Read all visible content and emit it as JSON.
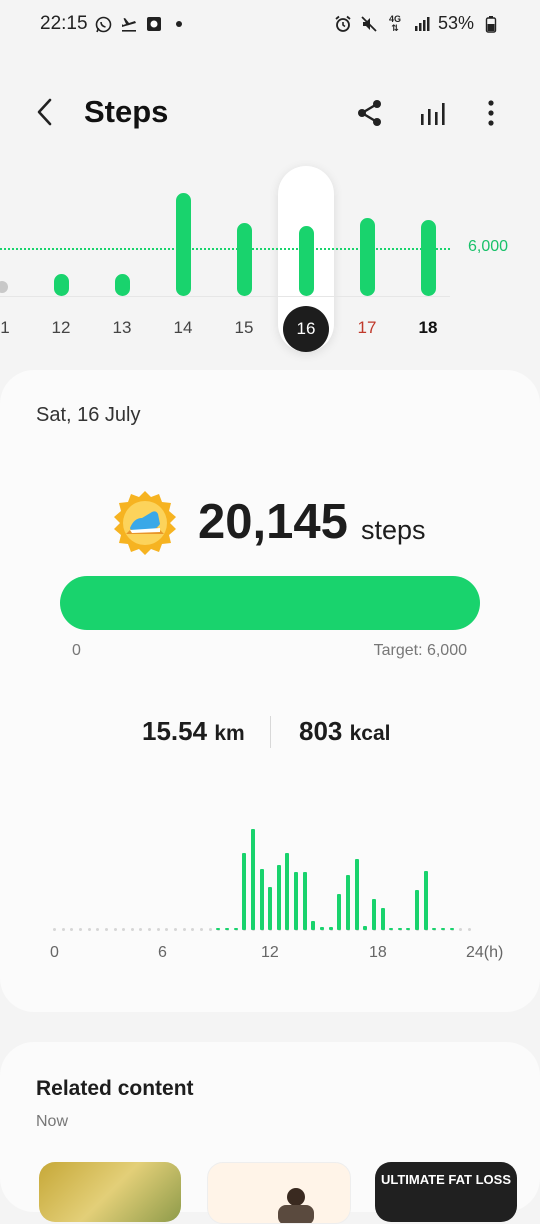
{
  "status_bar": {
    "time": "22:15",
    "signal_4g": "4G",
    "battery": "53%"
  },
  "header": {
    "title": "Steps"
  },
  "daily_chart": {
    "target_label": "6,000",
    "days": [
      "1",
      "12",
      "13",
      "14",
      "15",
      "16",
      "17",
      "18"
    ],
    "selected_day": "16"
  },
  "chart_data": {
    "type": "bar",
    "categories": [
      "12",
      "13",
      "14",
      "15",
      "16",
      "17",
      "18"
    ],
    "values": [
      2800,
      2800,
      12900,
      9100,
      8800,
      9700,
      9500
    ],
    "target": 6000,
    "selected": "16",
    "colors": {
      "bar": "#19d36d",
      "weekend": "#c0392b",
      "selected_bg": "#1d1d1d"
    }
  },
  "summary": {
    "date": "Sat, 16 July",
    "steps": "20,145",
    "steps_unit": "steps",
    "progress_start": "0",
    "target_text": "Target: 6,000",
    "progress_fraction": 1.0,
    "distance_value": "15.54",
    "distance_unit": "km",
    "calories_value": "803",
    "calories_unit": "kcal"
  },
  "hourly_chart": {
    "labels": [
      "0",
      "6",
      "12",
      "18",
      "24(h)"
    ],
    "chart_data": {
      "type": "bar",
      "hours": [
        9.5,
        10,
        10.5,
        11,
        11.5,
        12,
        12.5,
        13,
        13.5,
        14,
        14.5,
        15,
        15.5,
        16,
        16.5,
        17,
        17.5,
        18,
        18.5,
        19,
        19.5,
        20,
        20.5,
        21,
        21.5,
        22,
        22.5,
        23
      ],
      "values": [
        1,
        1,
        1,
        52,
        68,
        41,
        29,
        44,
        52,
        39,
        39,
        6,
        2,
        2,
        24,
        37,
        48,
        3,
        21,
        15,
        1,
        1,
        1,
        27,
        40,
        1,
        1,
        1
      ]
    }
  },
  "related": {
    "title": "Related content",
    "subtitle": "Now",
    "cards": [
      "",
      "",
      "ULTIMATE FAT LOSS"
    ]
  },
  "colors": {
    "accent": "#19d36d",
    "background": "#f4f4f4",
    "card": "#fbfbfb"
  }
}
